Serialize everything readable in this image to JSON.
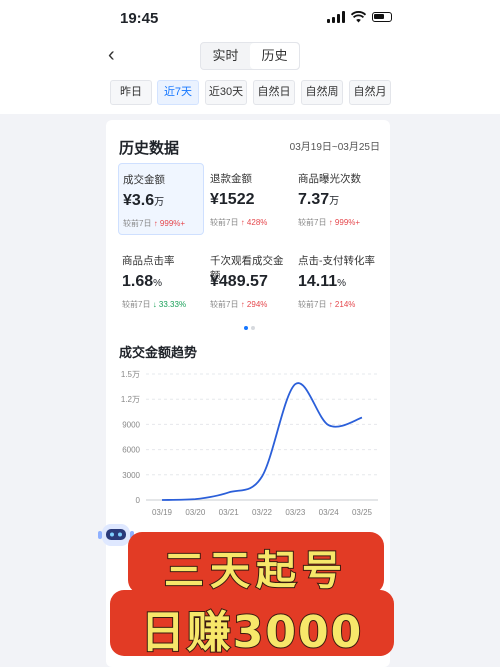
{
  "status": {
    "time": "19:45"
  },
  "nav": {
    "back": "‹",
    "tabs": [
      "实时",
      "历史"
    ],
    "active_tab": 1
  },
  "range_tabs": [
    "昨日",
    "近7天",
    "近30天",
    "自然日",
    "自然周",
    "自然月"
  ],
  "range_active": 1,
  "card": {
    "title": "历史数据",
    "date_range": "03月19日~03月25日"
  },
  "metrics": [
    {
      "name": "成交金额",
      "prefix": "¥",
      "value": "3.6",
      "unit": "万",
      "cmp_label": "较前7日",
      "arrow": "↑",
      "change": "999",
      "change_suffix": "%+",
      "direction": "up",
      "selected": true
    },
    {
      "name": "退款金额",
      "prefix": "¥",
      "value": "1522",
      "unit": "",
      "cmp_label": "较前7日",
      "arrow": "↑",
      "change": "428",
      "change_suffix": "%",
      "direction": "up",
      "selected": false
    },
    {
      "name": "商品曝光次数",
      "prefix": "",
      "value": "7.37",
      "unit": "万",
      "cmp_label": "较前7日",
      "arrow": "↑",
      "change": "999",
      "change_suffix": "%+",
      "direction": "up",
      "selected": false
    },
    {
      "name": "商品点击率",
      "prefix": "",
      "value": "1.68",
      "unit": "%",
      "cmp_label": "较前7日",
      "arrow": "↓",
      "change": "33.33",
      "change_suffix": "%",
      "direction": "down",
      "selected": false
    },
    {
      "name": "千次观看成交金额",
      "prefix": "¥",
      "value": "489.57",
      "unit": "",
      "cmp_label": "较前7日",
      "arrow": "↑",
      "change": "294",
      "change_suffix": "%",
      "direction": "up",
      "selected": false
    },
    {
      "name": "点击-支付转化率",
      "prefix": "",
      "value": "14.11",
      "unit": "%",
      "cmp_label": "较前7日",
      "arrow": "↑",
      "change": "214",
      "change_suffix": "%",
      "direction": "up",
      "selected": false
    }
  ],
  "pager": {
    "count": 2,
    "active": 0
  },
  "trend": {
    "title": "成交金额趋势"
  },
  "chart_data": {
    "type": "line",
    "title": "成交金额趋势",
    "x": [
      "03/19",
      "03/20",
      "03/21",
      "03/22",
      "03/23",
      "03/24",
      "03/25"
    ],
    "y_ticks": [
      "0",
      "3000",
      "6000",
      "9000",
      "1.2万",
      "1.5万"
    ],
    "ylim": [
      0,
      15000
    ],
    "series": [
      {
        "values": [
          0,
          100,
          900,
          2800,
          13800,
          8900,
          9800
        ]
      }
    ],
    "color": "#2b5fd9",
    "grid": true
  },
  "overlay": {
    "line1": "三天起号",
    "line2": "日赚3000",
    "color": "#e23b25",
    "text_color": "#f7e76a"
  }
}
